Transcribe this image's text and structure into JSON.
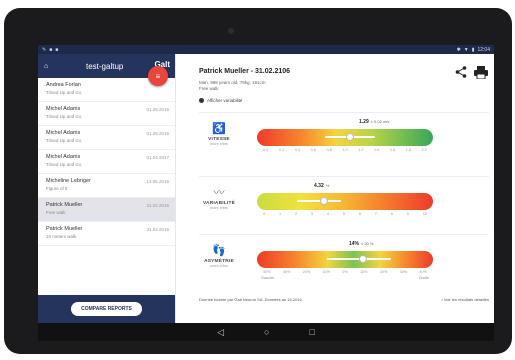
{
  "statusbar": {
    "time": "12:04"
  },
  "sidebar": {
    "title": "test-galtup",
    "right_label": "Galt",
    "items": [
      {
        "name": "Andrea Forlan",
        "sub": "Timed Up and Go",
        "date": ""
      },
      {
        "name": "Michel Adams",
        "sub": "Timed Up and Go",
        "date": "01.09.2016"
      },
      {
        "name": "Michel Adams",
        "sub": "Timed Up and Go",
        "date": "01.09.2016"
      },
      {
        "name": "Michel Adams",
        "sub": "Timed Up and Go",
        "date": "01.04.2017"
      },
      {
        "name": "Micheline Lebriger",
        "sub": "Figure of 8",
        "date": "13.05.2016"
      },
      {
        "name": "Patrick Mueller",
        "sub": "Free walk",
        "date": "31.02.2016"
      },
      {
        "name": "Patrick Mueller",
        "sub": "10 meters walk",
        "date": "31.02.2016"
      }
    ],
    "compare_label": "COMPARE REPORTS"
  },
  "main": {
    "patient_title": "Patrick Mueller - 31.02.2106",
    "patient_line1": "Man, 998 years old, 78kg, 181cm",
    "patient_line2": "Free walk",
    "changes_label": "Afficher variabilité",
    "metrics": [
      {
        "label": "VITESSE",
        "more": "more infos",
        "icon": "walker-icon",
        "glyph": "♿",
        "value": "1.29",
        "unit": "± 0.02 m/s",
        "fraction": 0.53,
        "ticks": [
          "0.0",
          "0.2",
          "0.4",
          "0.6",
          "0.8",
          "1.0",
          "1.2",
          "1.4",
          "1.6",
          "1.8",
          "2.0"
        ]
      },
      {
        "label": "VARIABILITÉ",
        "more": "more infos",
        "icon": "variability-icon",
        "glyph": "〰",
        "value": "4.32",
        "unit": "%",
        "fraction": 0.38,
        "ticks": [
          "0",
          "1",
          "2",
          "3",
          "4",
          "5",
          "6",
          "7",
          "8",
          "9",
          "10"
        ]
      },
      {
        "label": "ASYMÉTRIE",
        "more": "more infos",
        "icon": "footprints-icon",
        "glyph": "👣",
        "value": "14%",
        "unit": "± 20 %",
        "fraction": 0.6,
        "ticks": [
          "40%",
          "30%",
          "20%",
          "10%",
          "0%",
          "10%",
          "20%",
          "30%",
          "40%"
        ],
        "left_end": "Gauche",
        "right_end": "Droite"
      }
    ],
    "footer_left": "Donnée fournie par Gait Neuron SA. Données au 15.2016",
    "footer_right": "• Voir les résultats détaillés"
  },
  "colors": {
    "brand": "#25345c",
    "accent": "#e8453c"
  }
}
